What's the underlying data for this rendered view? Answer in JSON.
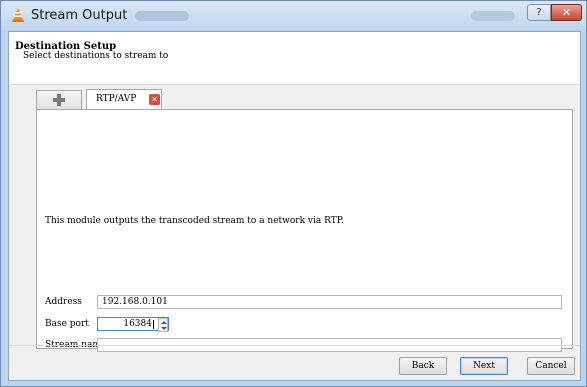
{
  "window": {
    "title": "Stream Output",
    "help_label": "?",
    "close_label": "✕"
  },
  "header": {
    "title": "Destination Setup",
    "subtitle": "Select destinations to stream to"
  },
  "tabs": {
    "add_icon": "plus-icon",
    "active_label": "RTP/AVP",
    "active_close": "✕"
  },
  "panel": {
    "description": "This module outputs the transcoded stream to a network via RTP.",
    "address_label": "Address",
    "address_value": "192.168.0.101",
    "base_port_label": "Base port",
    "base_port_value": "16384",
    "stream_name_label": "Stream name",
    "stream_name_value": ""
  },
  "buttons": {
    "back": "Back",
    "next": "Next",
    "cancel": "Cancel"
  },
  "colors": {
    "title_bar": "#bfd5ee",
    "close_button": "#c8452f",
    "focus_border": "#3d87d6",
    "tab_close": "#e04a3a"
  }
}
